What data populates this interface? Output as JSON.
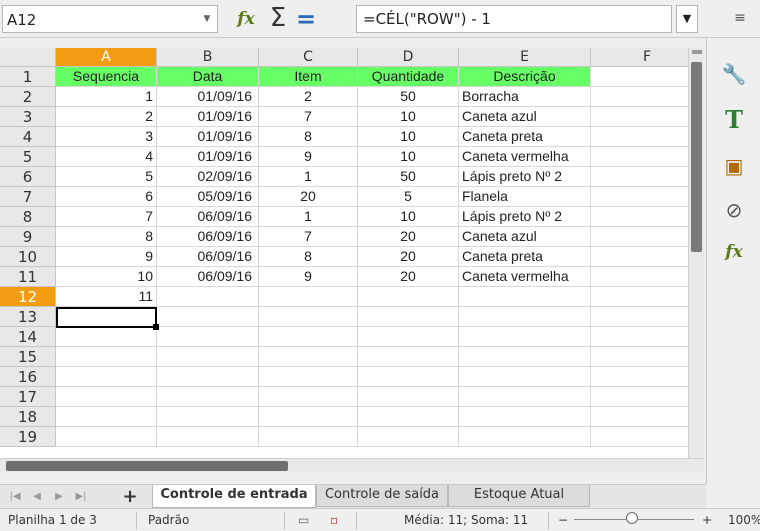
{
  "formula_bar": {
    "name_box": "A12",
    "formula": "=CÉL(\"ROW\") - 1"
  },
  "columns": [
    "A",
    "B",
    "C",
    "D",
    "E",
    "F"
  ],
  "selected_column": "A",
  "rows": [
    "1",
    "2",
    "3",
    "4",
    "5",
    "6",
    "7",
    "8",
    "9",
    "10",
    "11",
    "12",
    "13",
    "14",
    "15",
    "16",
    "17",
    "18",
    "19"
  ],
  "selected_row": "12",
  "sheet": {
    "headers": [
      "Sequencia",
      "Data",
      "Item",
      "Quantidade",
      "Descrição"
    ],
    "data": [
      [
        "1",
        "01/09/16",
        "2",
        "50",
        "Borracha"
      ],
      [
        "2",
        "01/09/16",
        "7",
        "10",
        "Caneta azul"
      ],
      [
        "3",
        "01/09/16",
        "8",
        "10",
        "Caneta preta"
      ],
      [
        "4",
        "01/09/16",
        "9",
        "10",
        "Caneta vermelha"
      ],
      [
        "5",
        "02/09/16",
        "1",
        "50",
        "Lápis preto Nº 2"
      ],
      [
        "6",
        "05/09/16",
        "20",
        "5",
        "Flanela"
      ],
      [
        "7",
        "06/09/16",
        "1",
        "10",
        "Lápis preto Nº 2"
      ],
      [
        "8",
        "06/09/16",
        "7",
        "20",
        "Caneta azul"
      ],
      [
        "9",
        "06/09/16",
        "8",
        "20",
        "Caneta preta"
      ],
      [
        "10",
        "06/09/16",
        "9",
        "20",
        "Caneta vermelha"
      ]
    ],
    "active_cell_value": "11"
  },
  "tabs": [
    "Controle de entrada",
    "Controle de saída",
    "Estoque Atual"
  ],
  "active_tab": "Controle de entrada",
  "status": {
    "sheet_info": "Planilha 1 de 3",
    "page_style": "Padrão",
    "summary": "Média: 11; Soma: 11",
    "zoom": "100%"
  },
  "colors": {
    "header_fill": "#66ff66",
    "selection": "#f39c11"
  },
  "icons": {
    "sidebar": [
      "properties-icon",
      "styles-icon",
      "gallery-icon",
      "navigator-icon",
      "functions-icon"
    ]
  }
}
